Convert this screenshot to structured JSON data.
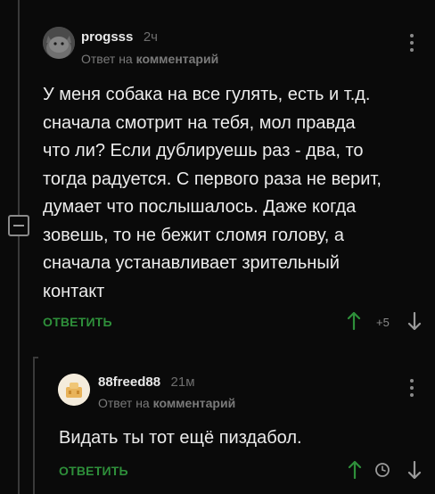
{
  "comments": [
    {
      "username": "progsss",
      "time": "2ч",
      "reply_prefix": "Ответ на",
      "reply_target": "комментарий",
      "text_lines": [
        "У меня собака на все гулять, есть и т.д.",
        "сначала смотрит на тебя, мол правда",
        "что ли? Если дублируешь раз - два, то",
        "тогда радуется. С первого раза не верит,",
        "думает что послышалось. Даже когда",
        "зовешь, то не бежит сломя голову, а",
        "сначала устанавливает зрительный",
        "контакт"
      ],
      "reply_label": "ОТВЕТИТЬ",
      "rating": "+5"
    },
    {
      "username": "88freed88",
      "time": "21м",
      "reply_prefix": "Ответ на",
      "reply_target": "комментарий",
      "text_lines": [
        "Видать ты тот ещё пиздабол."
      ],
      "reply_label": "ОТВЕТИТЬ"
    }
  ],
  "colors": {
    "background": "#0a0a0a",
    "accent_green": "#2e8f3a",
    "muted_text": "#7a7a7a",
    "thread_line": "#3a3a3a"
  },
  "icons": [
    "collapse-thread-icon",
    "more-options-icon",
    "upvote-arrow-icon",
    "downvote-arrow-icon",
    "rating-hidden-clock-icon"
  ]
}
